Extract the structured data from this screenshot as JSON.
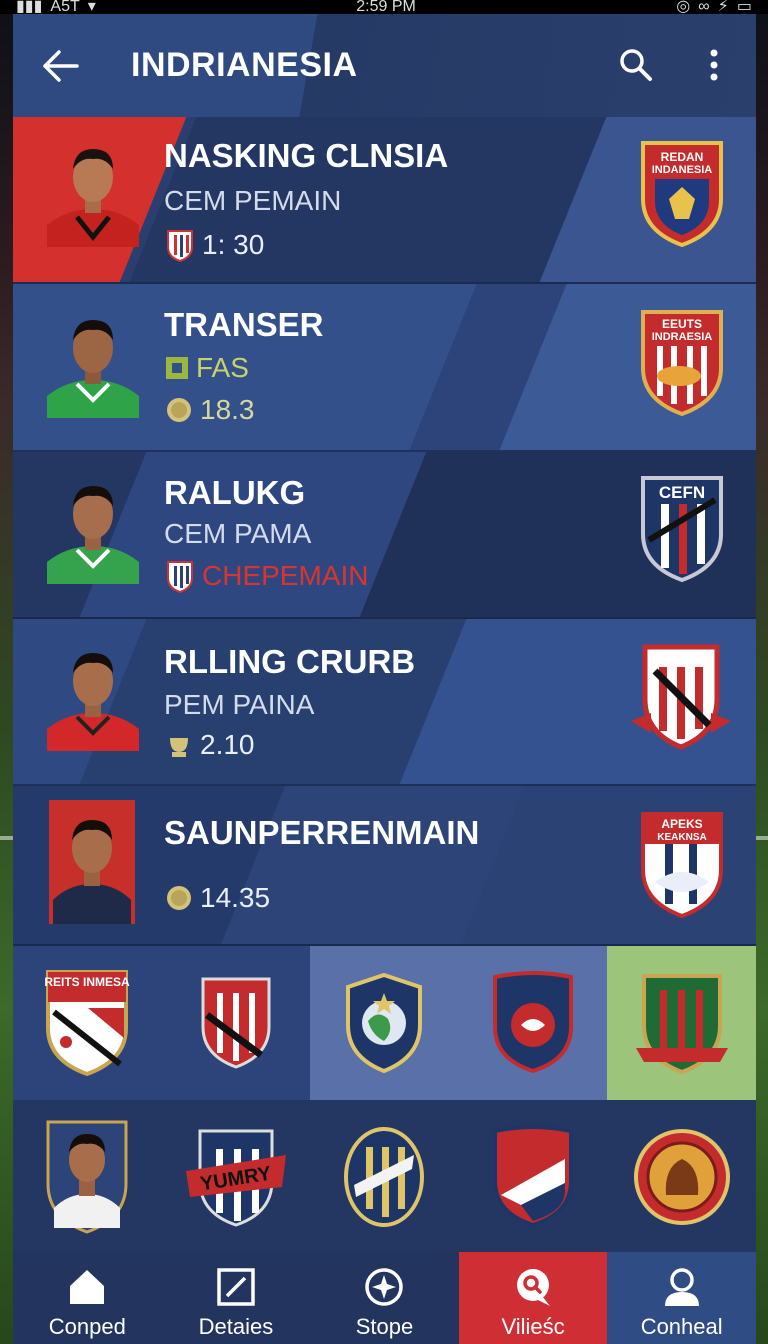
{
  "status": {
    "carrier": "A5T",
    "time": "2:59 PM"
  },
  "header": {
    "title": "INDRIANESIA"
  },
  "rows": [
    {
      "name": "NASKING CLNSIA",
      "sub": "CEM PEMAIN",
      "meta": "1: 30",
      "meta_color": "#e9eef9",
      "crest_text": "REDAN INDANESIA"
    },
    {
      "name": "TRANSER",
      "sub": "FAS",
      "sub_color": "#c8d070",
      "meta": "18.3",
      "meta_color": "#d8d89a",
      "crest_text": "EEUTS INDRAESIA"
    },
    {
      "name": "RALUKG",
      "sub": "CEM PAMA",
      "meta": "CHEPEMAIN",
      "meta_color": "#d9352f",
      "crest_text": "CEFN"
    },
    {
      "name": "RLLING CRURB",
      "sub": "PEM PAINA",
      "meta": "2.10",
      "meta_color": "#e9eef9",
      "crest_text": ""
    },
    {
      "name": "SAUNPERRENMAIN",
      "sub": "",
      "meta": "14.35",
      "meta_color": "#e9eef9",
      "crest_text": "APEKS KEAKNSA"
    }
  ],
  "badges_row1": [
    {
      "text": "REITS INMESA"
    },
    {
      "text": ""
    },
    {
      "text": ""
    },
    {
      "text": ""
    },
    {
      "text": ""
    }
  ],
  "badges_row2": [
    {
      "text": ""
    },
    {
      "text": "YUMRY"
    },
    {
      "text": ""
    },
    {
      "text": ""
    },
    {
      "text": ""
    }
  ],
  "nav": [
    {
      "label": "Conped",
      "icon": "home-icon"
    },
    {
      "label": "Detaies",
      "icon": "edit-square-icon"
    },
    {
      "label": "Stope",
      "icon": "compass-icon"
    },
    {
      "label": "Vilieśc",
      "icon": "search-bubble-icon"
    },
    {
      "label": "Conheal",
      "icon": "profile-icon"
    }
  ],
  "colors": {
    "accent_red": "#d4312e",
    "nav_active": "#cf2f34",
    "nav_profile": "#2f4c84",
    "frame": "#2c3f6c"
  }
}
